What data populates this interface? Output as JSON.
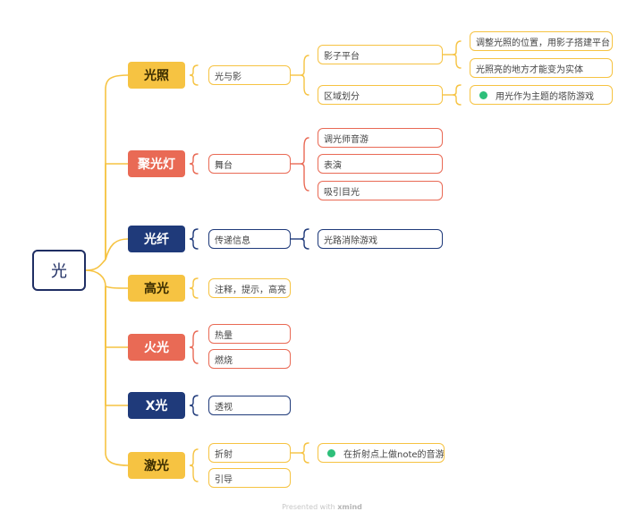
{
  "root": {
    "label": "光"
  },
  "categories": [
    {
      "id": "guangzhao",
      "label": "光照",
      "color": "#f6c342"
    },
    {
      "id": "juguangdeng",
      "label": "聚光灯",
      "color": "#e96a55"
    },
    {
      "id": "guangxian",
      "label": "光纤",
      "color": "#1f3a7a"
    },
    {
      "id": "gaoguang",
      "label": "高光",
      "color": "#f6c342"
    },
    {
      "id": "huoguang",
      "label": "火光",
      "color": "#e96a55"
    },
    {
      "id": "xguang",
      "label": "X光",
      "color": "#1f3a7a"
    },
    {
      "id": "jiguang",
      "label": "激光",
      "color": "#f6c342"
    }
  ],
  "guangzhao": {
    "topic": "光与影",
    "items": [
      "影子平台",
      "区域划分"
    ],
    "shadow_notes": [
      "调整光照的位置，用影子搭建平台",
      "光照亮的地方才能变为实体"
    ],
    "region_note": "用光作为主题的塔防游戏"
  },
  "juguangdeng": {
    "topic": "舞台",
    "items": [
      "调光师音游",
      "表演",
      "吸引目光"
    ]
  },
  "guangxian": {
    "topic": "传递信息",
    "note": "光路消除游戏"
  },
  "gaoguang": {
    "topic": "注释，提示，高亮"
  },
  "huoguang": {
    "items": [
      "热量",
      "燃烧"
    ]
  },
  "xguang": {
    "topic": "透视"
  },
  "jiguang": {
    "items": [
      "折射",
      "引导"
    ],
    "note": "在折射点上做note的音游"
  },
  "footer": {
    "prefix": "Presented with",
    "brand": "xmind"
  }
}
